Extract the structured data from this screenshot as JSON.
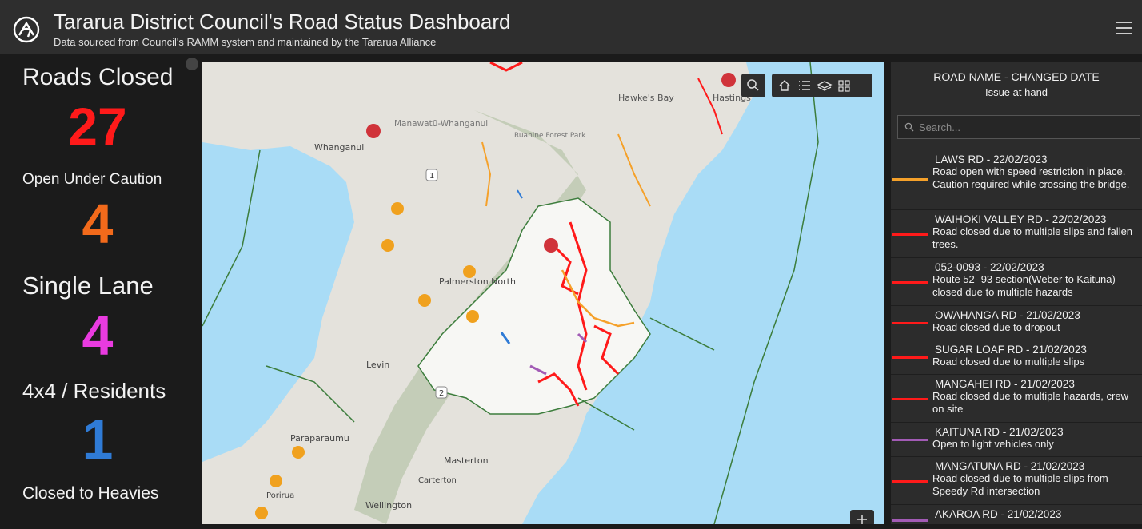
{
  "header": {
    "title": "Tararua District Council's Road Status Dashboard",
    "subtitle": "Data sourced from Council's RAMM system and maintained by the Tararua Alliance",
    "logo_icon": "road-logo-icon",
    "menu_icon": "hamburger-menu-icon"
  },
  "stats": [
    {
      "label": "Roads Closed",
      "value": "27",
      "color": "#ff1a1a"
    },
    {
      "label": "Open Under Caution",
      "value": "4",
      "color": "#f26a1b"
    },
    {
      "label": "Single Lane",
      "value": "4",
      "color": "#e93be0"
    },
    {
      "label": "4x4 / Residents",
      "value": "1",
      "color": "#2f7bd6"
    },
    {
      "label": "Closed to Heavies",
      "value": "",
      "color": "#ffffff"
    }
  ],
  "map": {
    "labels": {
      "hawkes_bay": "Hawke's Bay",
      "hastings": "Hastings",
      "manawatu": "Manawatū-Whanganui",
      "ruahine": "Ruahine Forest Park",
      "whanganui": "Whanganui",
      "palmerston": "Palmerston North",
      "levin": "Levin",
      "paraparaumu": "Paraparaumu",
      "masterton": "Masterton",
      "carterton": "Carterton",
      "porirua": "Porirua",
      "wellington": "Wellington",
      "shield1": "1",
      "shield2": "2"
    },
    "tools": [
      "search-icon",
      "home-icon",
      "legend-icon",
      "layers-icon",
      "qr-code-icon"
    ]
  },
  "list": {
    "header_line1": "ROAD NAME - CHANGED DATE",
    "header_line2": "Issue at hand",
    "search_placeholder": "Search...",
    "items": [
      {
        "name": "LAWS RD - 22/02/2023",
        "desc": "Road open with speed restriction in place. Caution required while crossing the bridge.",
        "color": "#f5a12a"
      },
      {
        "name": "WAIHOKI VALLEY RD - 22/02/2023",
        "desc": "Road closed due to multiple slips and fallen trees.",
        "color": "#ff1a1a"
      },
      {
        "name": "052-0093 - 22/02/2023",
        "desc": "Route 52- 93 section(Weber to Kaituna) closed due to multiple hazards",
        "color": "#ff1a1a"
      },
      {
        "name": "OWAHANGA RD - 21/02/2023",
        "desc": "Road closed due to dropout",
        "color": "#ff1a1a"
      },
      {
        "name": "SUGAR LOAF RD - 21/02/2023",
        "desc": "Road closed due to multiple slips",
        "color": "#ff1a1a"
      },
      {
        "name": "MANGAHEI RD - 21/02/2023",
        "desc": "Road closed due to multiple hazards, crew on site",
        "color": "#ff1a1a"
      },
      {
        "name": "KAITUNA RD - 21/02/2023",
        "desc": "Open to light vehicles only",
        "color": "#a25bb5"
      },
      {
        "name": "MANGATUNA RD - 21/02/2023",
        "desc": "Road closed due to multiple slips from Speedy Rd intersection",
        "color": "#ff1a1a"
      },
      {
        "name": "AKAROA RD - 21/02/2023",
        "desc": "",
        "color": "#a25bb5"
      }
    ]
  }
}
